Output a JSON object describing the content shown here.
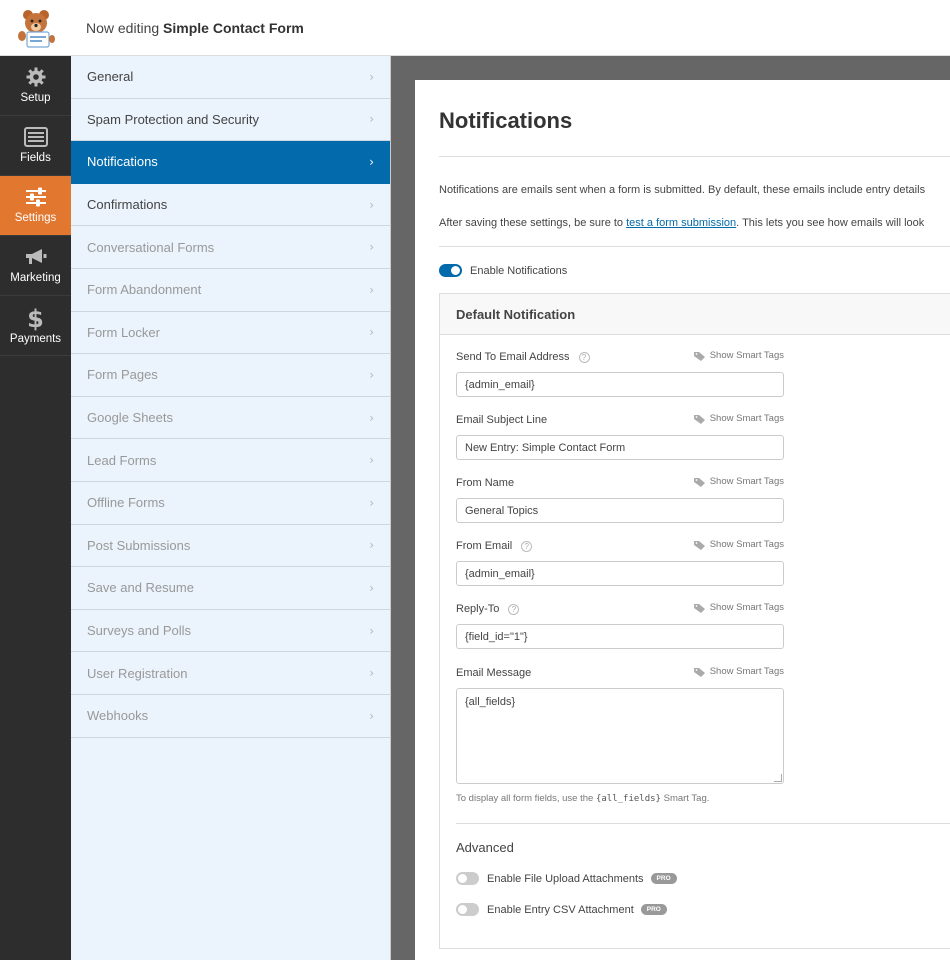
{
  "header": {
    "editing_prefix": "Now editing",
    "form_name": "Simple Contact Form"
  },
  "rail": {
    "items": [
      {
        "label": "Setup",
        "icon": "gear-icon"
      },
      {
        "label": "Fields",
        "icon": "fields-icon"
      },
      {
        "label": "Settings",
        "icon": "sliders-icon",
        "active": true
      },
      {
        "label": "Marketing",
        "icon": "megaphone-icon"
      },
      {
        "label": "Payments",
        "icon": "dollar-icon"
      }
    ]
  },
  "panels": {
    "items": [
      {
        "label": "General"
      },
      {
        "label": "Spam Protection and Security"
      },
      {
        "label": "Notifications",
        "active": true
      },
      {
        "label": "Confirmations"
      },
      {
        "label": "Conversational Forms",
        "disabled": true
      },
      {
        "label": "Form Abandonment",
        "disabled": true
      },
      {
        "label": "Form Locker",
        "disabled": true
      },
      {
        "label": "Form Pages",
        "disabled": true
      },
      {
        "label": "Google Sheets",
        "disabled": true
      },
      {
        "label": "Lead Forms",
        "disabled": true
      },
      {
        "label": "Offline Forms",
        "disabled": true
      },
      {
        "label": "Post Submissions",
        "disabled": true
      },
      {
        "label": "Save and Resume",
        "disabled": true
      },
      {
        "label": "Surveys and Polls",
        "disabled": true
      },
      {
        "label": "User Registration",
        "disabled": true
      },
      {
        "label": "Webhooks",
        "disabled": true
      }
    ]
  },
  "main": {
    "title": "Notifications",
    "intro": "Notifications are emails sent when a form is submitted. By default, these emails include entry details",
    "after_prefix": "After saving these settings, be sure to",
    "after_link": "test a form submission",
    "after_suffix": ". This lets you see how emails will look",
    "enable_label": "Enable Notifications",
    "enable_on": true
  },
  "notification": {
    "title": "Default Notification",
    "smart_tags_label": "Show Smart Tags",
    "fields": {
      "send_to": {
        "label": "Send To Email Address",
        "value": "{admin_email}"
      },
      "subject": {
        "label": "Email Subject Line",
        "value": "New Entry: Simple Contact Form"
      },
      "from_name": {
        "label": "From Name",
        "value": "General Topics"
      },
      "from_email": {
        "label": "From Email",
        "value": "{admin_email}"
      },
      "reply_to": {
        "label": "Reply-To",
        "value": "{field_id=\"1\"}"
      },
      "message": {
        "label": "Email Message",
        "value": "{all_fields}"
      }
    },
    "hint_prefix": "To display all form fields, use the",
    "hint_code": "{all_fields}",
    "hint_suffix": "Smart Tag.",
    "advanced_title": "Advanced",
    "file_upload_label": "Enable File Upload Attachments",
    "csv_label": "Enable Entry CSV Attachment",
    "pro_badge": "PRO"
  },
  "colors": {
    "accent_blue": "#036aab",
    "settings_orange": "#e27730",
    "rail_dark": "#2d2d2d",
    "panel_bg": "#ebf3fc"
  }
}
